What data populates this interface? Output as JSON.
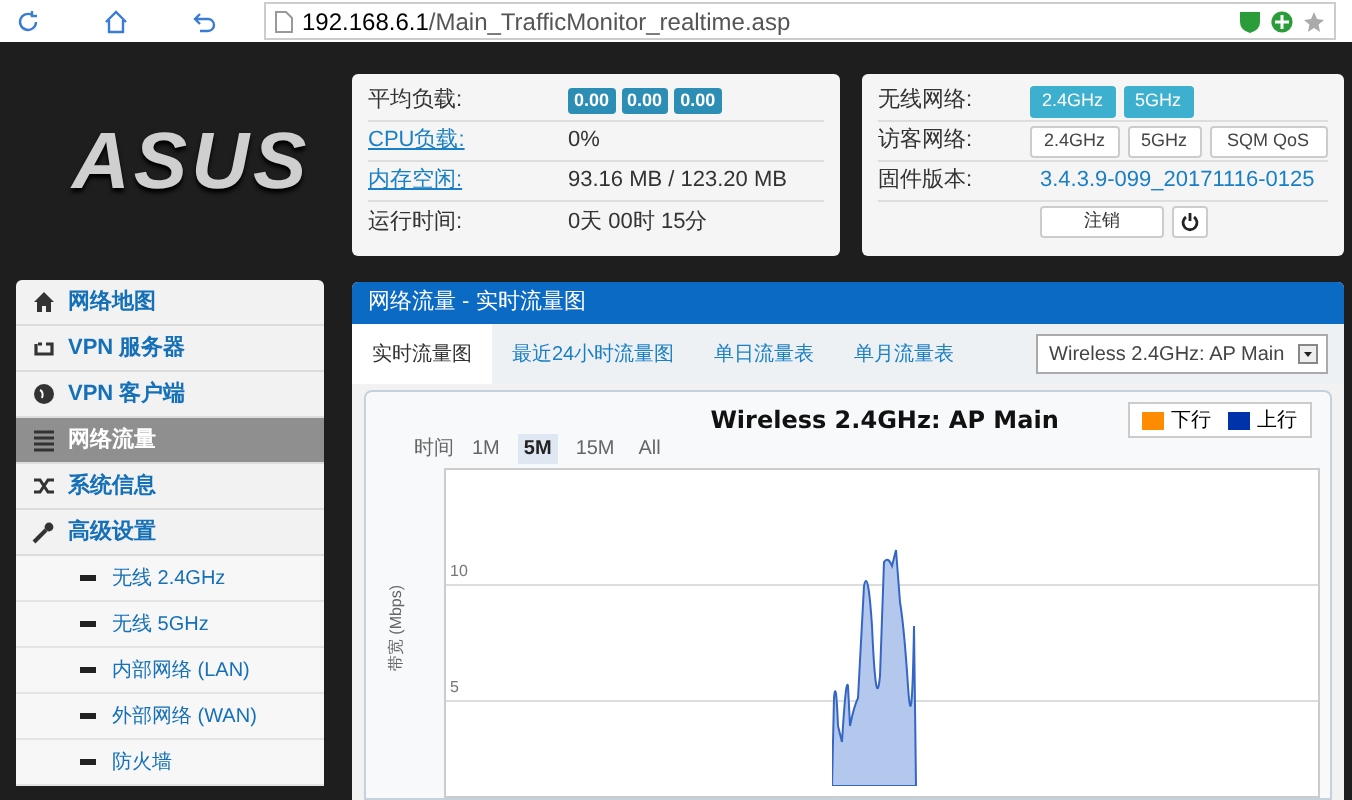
{
  "browser": {
    "url_host": "192.168.6.1",
    "url_path": "/Main_TrafficMonitor_realtime.asp"
  },
  "logo": {
    "text": "ASUS"
  },
  "status_panel": {
    "rows": [
      {
        "label": "平均负载:",
        "link": false,
        "badges": [
          "0.00",
          "0.00",
          "0.00"
        ]
      },
      {
        "label": "CPU负载:",
        "link": true,
        "value": "0%"
      },
      {
        "label": "内存空闲:",
        "link": true,
        "value": "93.16 MB / 123.20 MB"
      },
      {
        "label": "运行时间:",
        "link": false,
        "value": "0天 00时 15分"
      }
    ]
  },
  "network_panel": {
    "wireless": {
      "label": "无线网络:",
      "buttons": [
        {
          "label": "2.4GHz",
          "on": true
        },
        {
          "label": "5GHz",
          "on": true
        }
      ]
    },
    "guest": {
      "label": "访客网络:",
      "buttons": [
        {
          "label": "2.4GHz",
          "on": false
        },
        {
          "label": "5GHz",
          "on": false
        },
        {
          "label": "SQM QoS",
          "on": false
        }
      ]
    },
    "firmware": {
      "label": "固件版本:",
      "value": "3.4.3.9-099_20171116-0125"
    },
    "logout": "注销"
  },
  "sidebar": {
    "items": [
      {
        "label": "网络地图",
        "selected": false
      },
      {
        "label": "VPN 服务器",
        "selected": false
      },
      {
        "label": "VPN 客户端",
        "selected": false
      },
      {
        "label": "网络流量",
        "selected": true
      },
      {
        "label": "系统信息",
        "selected": false
      },
      {
        "label": "高级设置",
        "selected": false,
        "children": [
          {
            "label": "无线 2.4GHz"
          },
          {
            "label": "无线 5GHz"
          },
          {
            "label": "内部网络 (LAN)"
          },
          {
            "label": "外部网络 (WAN)"
          },
          {
            "label": "防火墙"
          }
        ]
      }
    ]
  },
  "main": {
    "title": "网络流量 - 实时流量图",
    "tabs": [
      {
        "label": "实时流量图",
        "selected": true
      },
      {
        "label": "最近24小时流量图",
        "selected": false
      },
      {
        "label": "单日流量表",
        "selected": false
      },
      {
        "label": "单月流量表",
        "selected": false
      }
    ],
    "interface_select": {
      "value": "Wireless 2.4GHz: AP Main"
    },
    "chart": {
      "title": "Wireless 2.4GHz: AP Main",
      "time_label": "时间",
      "ranges": [
        {
          "label": "1M",
          "selected": false
        },
        {
          "label": "5M",
          "selected": true
        },
        {
          "label": "15M",
          "selected": false
        },
        {
          "label": "All",
          "selected": false
        }
      ],
      "legend": [
        {
          "label": "下行",
          "color": "#ff8c00"
        },
        {
          "label": "上行",
          "color": "#0033aa"
        }
      ],
      "ylabel": "带宽 (Mbps)",
      "yticks": [
        "10",
        "5"
      ]
    }
  }
}
